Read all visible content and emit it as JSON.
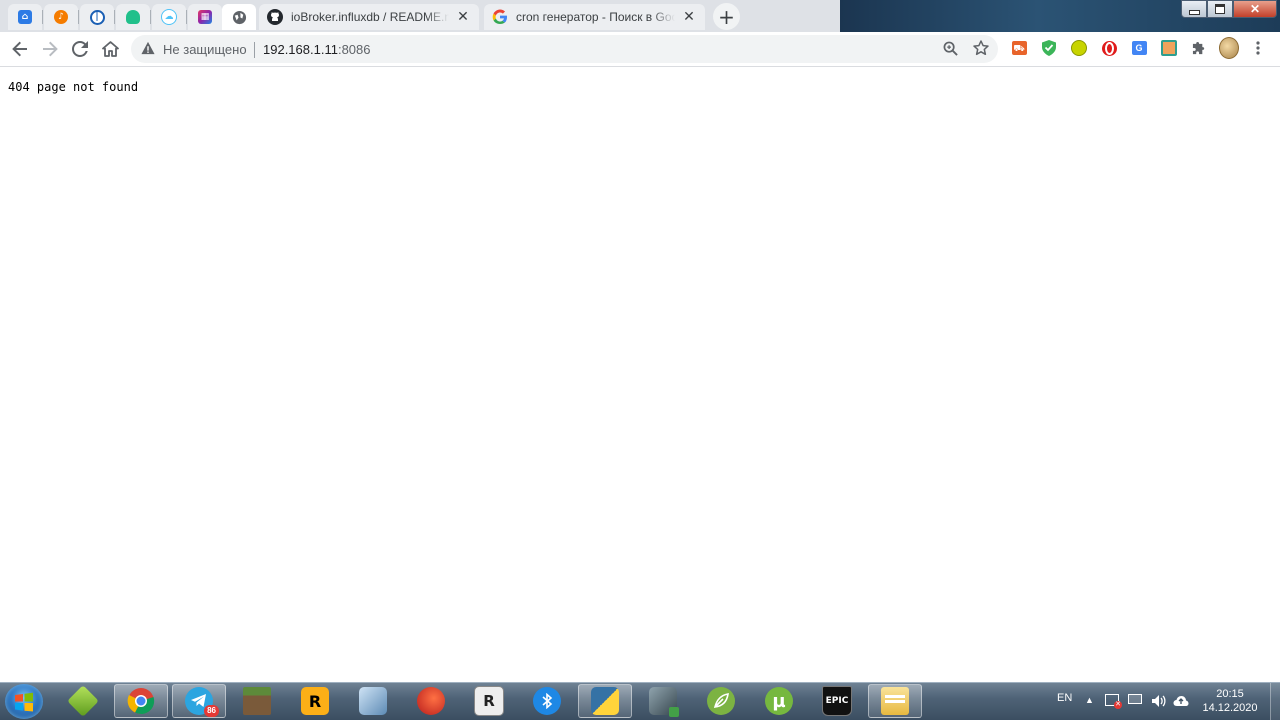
{
  "browser": {
    "tabs": [
      {
        "name": "pinned-tab-1",
        "icon": "home-cloud-icon",
        "color": "#2d7be5"
      },
      {
        "name": "pinned-tab-2",
        "icon": "music-note-icon",
        "color": "#f57c00"
      },
      {
        "name": "pinned-tab-3",
        "icon": "one-password-icon",
        "color": "#1a5fb4"
      },
      {
        "name": "pinned-tab-4",
        "icon": "cloud-icon",
        "color": "#21c08b"
      },
      {
        "name": "pinned-tab-5",
        "icon": "weather-icon",
        "color": "#4fc3f7"
      },
      {
        "name": "pinned-tab-6",
        "icon": "app-grid-icon",
        "color": "#e53965"
      },
      {
        "name": "pinned-tab-7",
        "icon": "globe-icon",
        "color": "#5f6368",
        "active": true
      }
    ],
    "full_tabs": [
      {
        "title": "ioBroker.influxdb / README.md at",
        "icon": "github-icon"
      },
      {
        "title": "cron генератор - Поиск в Google",
        "icon": "google-icon"
      }
    ],
    "security_label": "Не защищено",
    "url_host": "192.168.1.11",
    "url_port": ":8086"
  },
  "page": {
    "text": "404 page not found"
  },
  "taskbar": {
    "apps": [
      {
        "name": "app-3d-box",
        "color": "#8bc34a",
        "label": ""
      },
      {
        "name": "app-chrome",
        "color": "#db4437",
        "label": "",
        "open": true
      },
      {
        "name": "app-telegram",
        "color": "#2ca5e0",
        "label": "",
        "badge": "86",
        "open": true
      },
      {
        "name": "app-minecraft",
        "color": "#5d8a3a",
        "label": ""
      },
      {
        "name": "app-rockstar",
        "color": "#fcaf17",
        "label": "R"
      },
      {
        "name": "app-network-tool",
        "color": "#7a9bb8",
        "label": ""
      },
      {
        "name": "app-ccleaner",
        "color": "#d84315",
        "label": ""
      },
      {
        "name": "app-rufus",
        "color": "#e0e0e0",
        "label": "R"
      },
      {
        "name": "app-bluetooth",
        "color": "#1e88e5",
        "label": ""
      },
      {
        "name": "app-python",
        "color": "#3572a5",
        "label": "",
        "open": true
      },
      {
        "name": "app-connection",
        "color": "#455a64",
        "label": ""
      },
      {
        "name": "app-leaf",
        "color": "#7cb342",
        "label": ""
      },
      {
        "name": "app-utorrent",
        "color": "#76b83f",
        "label": "µ"
      },
      {
        "name": "app-epic-games",
        "color": "#111111",
        "label": "EPIC"
      },
      {
        "name": "app-explorer",
        "color": "#f6d365",
        "label": "",
        "open": true
      }
    ],
    "language": "EN",
    "time": "20:15",
    "date": "14.12.2020"
  }
}
